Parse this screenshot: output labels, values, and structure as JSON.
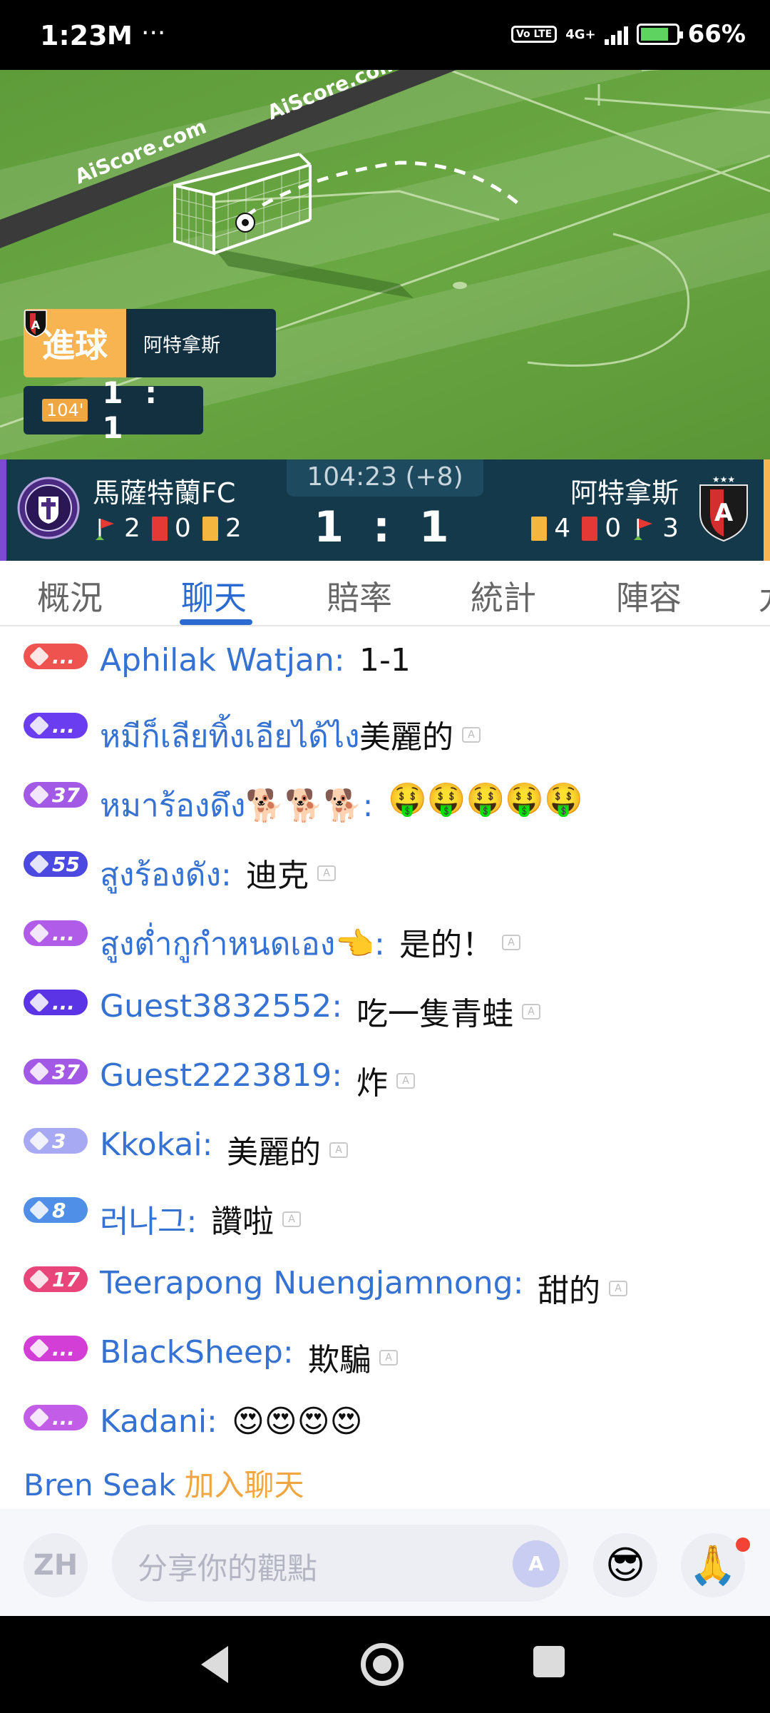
{
  "status_bar": {
    "time": "1:23",
    "mail_icon": "M",
    "more": "···",
    "network": "4G+",
    "volte": "Vo LTE",
    "battery": "66%"
  },
  "pitch": {
    "banner_text": "AiScore.com",
    "goal_label": "進球",
    "goal_team": "阿特拿斯",
    "minute": "104'",
    "score": "1 : 1"
  },
  "scoreboard": {
    "match_time": "104:23 (+8)",
    "score": "1 : 1",
    "home": {
      "name": "馬薩特蘭FC",
      "corners": "2",
      "red": "0",
      "yellow": "2"
    },
    "away": {
      "name": "阿特拿斯",
      "yellow": "4",
      "red": "0",
      "corners": "3"
    }
  },
  "tabs": [
    "概況",
    "聊天",
    "賠率",
    "統計",
    "陣容",
    "九"
  ],
  "active_tab": "聊天",
  "chat": [
    {
      "badge": "...",
      "badge_color": "#ef5350",
      "user": "Aphilak Watjan:",
      "message": "1-1",
      "translate": false
    },
    {
      "badge": "...",
      "badge_color": "#6a3df0",
      "user": "หมีก็เลียทิ้งเอียได้ไง",
      "message": "美麗的",
      "translate": true
    },
    {
      "badge": "37",
      "badge_color": "#a259e6",
      "user": "หมาร้องดึง🐕🐕🐕:",
      "message": "🤑🤑🤑🤑🤑",
      "translate": false
    },
    {
      "badge": "55",
      "badge_color": "#4b49e0",
      "user": "สูงร้องดัง:",
      "message": "迪克",
      "translate": true
    },
    {
      "badge": "...",
      "badge_color": "#b05ce8",
      "user": "สูงต่ำกูกำหนดเอง👈:",
      "message": "是的！",
      "translate": true
    },
    {
      "badge": "...",
      "badge_color": "#5b34e6",
      "user": "Guest3832552:",
      "message": "吃一隻青蛙",
      "translate": true
    },
    {
      "badge": "37",
      "badge_color": "#a259e6",
      "user": "Guest2223819:",
      "message": "炸",
      "translate": true
    },
    {
      "badge": "3",
      "badge_color": "#a7a9f2",
      "user": "Kkokai:",
      "message": "美麗的",
      "translate": true
    },
    {
      "badge": "8",
      "badge_color": "#4f8fe8",
      "user": "러나그:",
      "message": "讚啦",
      "translate": true
    },
    {
      "badge": "17",
      "badge_color": "#e8467a",
      "user": "Teerapong Nuengjamnong:",
      "message": "甜的",
      "translate": true
    },
    {
      "badge": "...",
      "badge_color": "#d33fd6",
      "user": "BlackSheep:",
      "message": "欺騙",
      "translate": true
    },
    {
      "badge": "...",
      "badge_color": "#c25de8",
      "user": "Kadani:",
      "message": "😍😍😍😍",
      "translate": false
    }
  ],
  "join": {
    "user": "Bren Seak",
    "text": "加入聊天"
  },
  "input": {
    "lang": "ZH",
    "placeholder": "分享你的觀點",
    "ai": "A",
    "emoji1": "😎",
    "emoji2": "🙏"
  }
}
